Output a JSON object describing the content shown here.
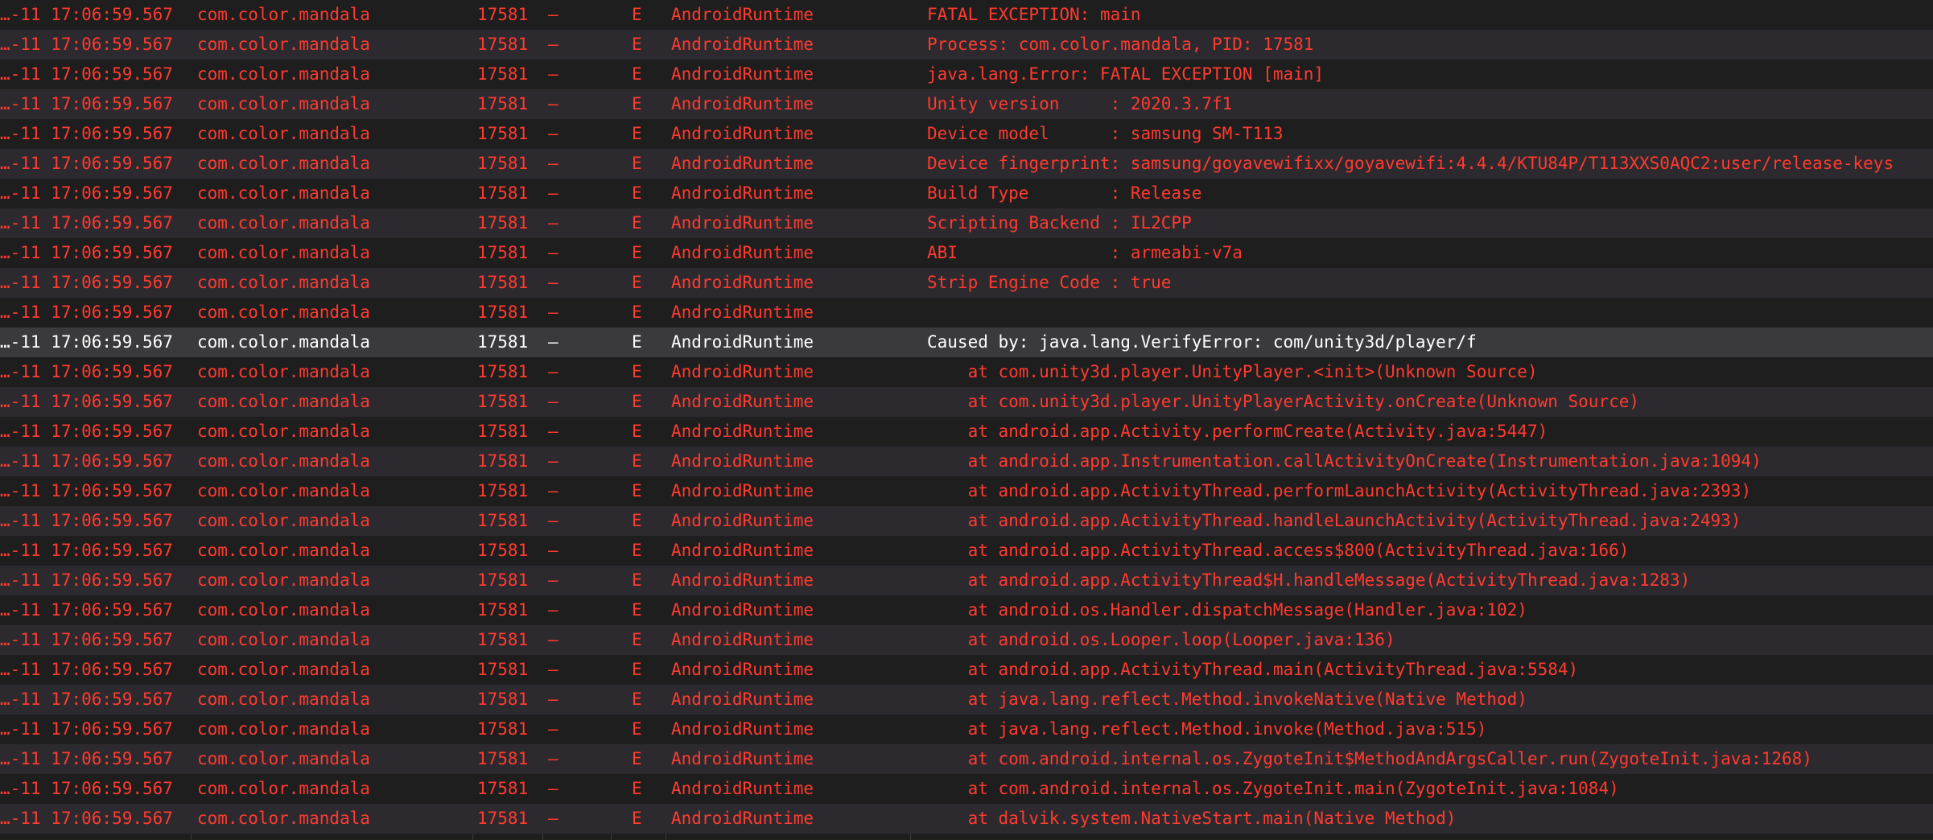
{
  "colors": {
    "error_text": "#ff3b30",
    "selected_text": "#ffffff",
    "row_even": "#2c2a2e",
    "row_odd": "#1e1e1e",
    "row_selected": "#3a3a3c"
  },
  "columns": [
    "time",
    "process",
    "pid",
    "tid",
    "level",
    "tag",
    "message"
  ],
  "log": {
    "rows": [
      {
        "time": "…-11 17:06:59.567",
        "process": "com.color.mandala",
        "pid": "17581",
        "tid": "–",
        "level": "E",
        "tag": "AndroidRuntime",
        "message": "FATAL EXCEPTION: main",
        "selected": false
      },
      {
        "time": "…-11 17:06:59.567",
        "process": "com.color.mandala",
        "pid": "17581",
        "tid": "–",
        "level": "E",
        "tag": "AndroidRuntime",
        "message": "Process: com.color.mandala, PID: 17581",
        "selected": false
      },
      {
        "time": "…-11 17:06:59.567",
        "process": "com.color.mandala",
        "pid": "17581",
        "tid": "–",
        "level": "E",
        "tag": "AndroidRuntime",
        "message": "java.lang.Error: FATAL EXCEPTION [main]",
        "selected": false
      },
      {
        "time": "…-11 17:06:59.567",
        "process": "com.color.mandala",
        "pid": "17581",
        "tid": "–",
        "level": "E",
        "tag": "AndroidRuntime",
        "message": "Unity version     : 2020.3.7f1",
        "selected": false
      },
      {
        "time": "…-11 17:06:59.567",
        "process": "com.color.mandala",
        "pid": "17581",
        "tid": "–",
        "level": "E",
        "tag": "AndroidRuntime",
        "message": "Device model      : samsung SM-T113",
        "selected": false
      },
      {
        "time": "…-11 17:06:59.567",
        "process": "com.color.mandala",
        "pid": "17581",
        "tid": "–",
        "level": "E",
        "tag": "AndroidRuntime",
        "message": "Device fingerprint: samsung/goyavewifixx/goyavewifi:4.4.4/KTU84P/T113XXS0AQC2:user/release-keys",
        "selected": false
      },
      {
        "time": "…-11 17:06:59.567",
        "process": "com.color.mandala",
        "pid": "17581",
        "tid": "–",
        "level": "E",
        "tag": "AndroidRuntime",
        "message": "Build Type        : Release",
        "selected": false
      },
      {
        "time": "…-11 17:06:59.567",
        "process": "com.color.mandala",
        "pid": "17581",
        "tid": "–",
        "level": "E",
        "tag": "AndroidRuntime",
        "message": "Scripting Backend : IL2CPP",
        "selected": false
      },
      {
        "time": "…-11 17:06:59.567",
        "process": "com.color.mandala",
        "pid": "17581",
        "tid": "–",
        "level": "E",
        "tag": "AndroidRuntime",
        "message": "ABI               : armeabi-v7a",
        "selected": false
      },
      {
        "time": "…-11 17:06:59.567",
        "process": "com.color.mandala",
        "pid": "17581",
        "tid": "–",
        "level": "E",
        "tag": "AndroidRuntime",
        "message": "Strip Engine Code : true",
        "selected": false
      },
      {
        "time": "…-11 17:06:59.567",
        "process": "com.color.mandala",
        "pid": "17581",
        "tid": "–",
        "level": "E",
        "tag": "AndroidRuntime",
        "message": "",
        "selected": false
      },
      {
        "time": "…-11 17:06:59.567",
        "process": "com.color.mandala",
        "pid": "17581",
        "tid": "–",
        "level": "E",
        "tag": "AndroidRuntime",
        "message": "Caused by: java.lang.VerifyError: com/unity3d/player/f",
        "selected": true
      },
      {
        "time": "…-11 17:06:59.567",
        "process": "com.color.mandala",
        "pid": "17581",
        "tid": "–",
        "level": "E",
        "tag": "AndroidRuntime",
        "message": "    at com.unity3d.player.UnityPlayer.<init>(Unknown Source)",
        "selected": false
      },
      {
        "time": "…-11 17:06:59.567",
        "process": "com.color.mandala",
        "pid": "17581",
        "tid": "–",
        "level": "E",
        "tag": "AndroidRuntime",
        "message": "    at com.unity3d.player.UnityPlayerActivity.onCreate(Unknown Source)",
        "selected": false
      },
      {
        "time": "…-11 17:06:59.567",
        "process": "com.color.mandala",
        "pid": "17581",
        "tid": "–",
        "level": "E",
        "tag": "AndroidRuntime",
        "message": "    at android.app.Activity.performCreate(Activity.java:5447)",
        "selected": false
      },
      {
        "time": "…-11 17:06:59.567",
        "process": "com.color.mandala",
        "pid": "17581",
        "tid": "–",
        "level": "E",
        "tag": "AndroidRuntime",
        "message": "    at android.app.Instrumentation.callActivityOnCreate(Instrumentation.java:1094)",
        "selected": false
      },
      {
        "time": "…-11 17:06:59.567",
        "process": "com.color.mandala",
        "pid": "17581",
        "tid": "–",
        "level": "E",
        "tag": "AndroidRuntime",
        "message": "    at android.app.ActivityThread.performLaunchActivity(ActivityThread.java:2393)",
        "selected": false
      },
      {
        "time": "…-11 17:06:59.567",
        "process": "com.color.mandala",
        "pid": "17581",
        "tid": "–",
        "level": "E",
        "tag": "AndroidRuntime",
        "message": "    at android.app.ActivityThread.handleLaunchActivity(ActivityThread.java:2493)",
        "selected": false
      },
      {
        "time": "…-11 17:06:59.567",
        "process": "com.color.mandala",
        "pid": "17581",
        "tid": "–",
        "level": "E",
        "tag": "AndroidRuntime",
        "message": "    at android.app.ActivityThread.access$800(ActivityThread.java:166)",
        "selected": false
      },
      {
        "time": "…-11 17:06:59.567",
        "process": "com.color.mandala",
        "pid": "17581",
        "tid": "–",
        "level": "E",
        "tag": "AndroidRuntime",
        "message": "    at android.app.ActivityThread$H.handleMessage(ActivityThread.java:1283)",
        "selected": false
      },
      {
        "time": "…-11 17:06:59.567",
        "process": "com.color.mandala",
        "pid": "17581",
        "tid": "–",
        "level": "E",
        "tag": "AndroidRuntime",
        "message": "    at android.os.Handler.dispatchMessage(Handler.java:102)",
        "selected": false
      },
      {
        "time": "…-11 17:06:59.567",
        "process": "com.color.mandala",
        "pid": "17581",
        "tid": "–",
        "level": "E",
        "tag": "AndroidRuntime",
        "message": "    at android.os.Looper.loop(Looper.java:136)",
        "selected": false
      },
      {
        "time": "…-11 17:06:59.567",
        "process": "com.color.mandala",
        "pid": "17581",
        "tid": "–",
        "level": "E",
        "tag": "AndroidRuntime",
        "message": "    at android.app.ActivityThread.main(ActivityThread.java:5584)",
        "selected": false
      },
      {
        "time": "…-11 17:06:59.567",
        "process": "com.color.mandala",
        "pid": "17581",
        "tid": "–",
        "level": "E",
        "tag": "AndroidRuntime",
        "message": "    at java.lang.reflect.Method.invokeNative(Native Method)",
        "selected": false
      },
      {
        "time": "…-11 17:06:59.567",
        "process": "com.color.mandala",
        "pid": "17581",
        "tid": "–",
        "level": "E",
        "tag": "AndroidRuntime",
        "message": "    at java.lang.reflect.Method.invoke(Method.java:515)",
        "selected": false
      },
      {
        "time": "…-11 17:06:59.567",
        "process": "com.color.mandala",
        "pid": "17581",
        "tid": "–",
        "level": "E",
        "tag": "AndroidRuntime",
        "message": "    at com.android.internal.os.ZygoteInit$MethodAndArgsCaller.run(ZygoteInit.java:1268)",
        "selected": false
      },
      {
        "time": "…-11 17:06:59.567",
        "process": "com.color.mandala",
        "pid": "17581",
        "tid": "–",
        "level": "E",
        "tag": "AndroidRuntime",
        "message": "    at com.android.internal.os.ZygoteInit.main(ZygoteInit.java:1084)",
        "selected": false
      },
      {
        "time": "…-11 17:06:59.567",
        "process": "com.color.mandala",
        "pid": "17581",
        "tid": "–",
        "level": "E",
        "tag": "AndroidRuntime",
        "message": "    at dalvik.system.NativeStart.main(Native Method)",
        "selected": false
      }
    ]
  }
}
